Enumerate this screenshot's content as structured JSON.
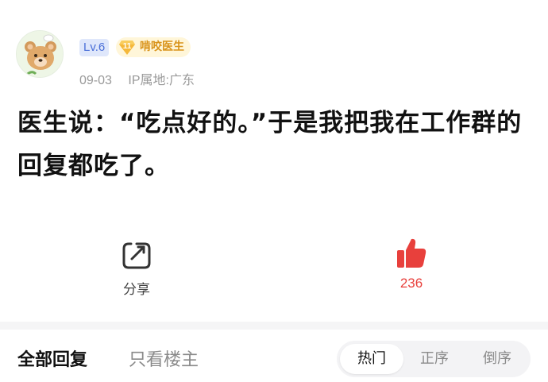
{
  "post": {
    "level": "Lv.6",
    "badge": {
      "number": "11",
      "text": "啃咬医生"
    },
    "date": "09-03",
    "location": "IP属地:广东",
    "text": "医生说：“吃点好的。”于是我把我在工作群的回复都吃了。"
  },
  "actions": {
    "share_label": "分享",
    "like_count": "236"
  },
  "replies": {
    "tab_all": "全部回复",
    "tab_owner": "只看楼主",
    "sort": [
      "热门",
      "正序",
      "倒序"
    ],
    "sort_selected": "热门"
  },
  "icons": {
    "avatar": "bear-avatar-icon",
    "share": "share-icon",
    "like": "thumbs-up-icon",
    "badge": "gem-badge-icon"
  },
  "colors": {
    "like": "#e8403c",
    "level_bg": "#dfe7fb",
    "level_text": "#4a6fd8",
    "badge_text": "#d9931a"
  }
}
